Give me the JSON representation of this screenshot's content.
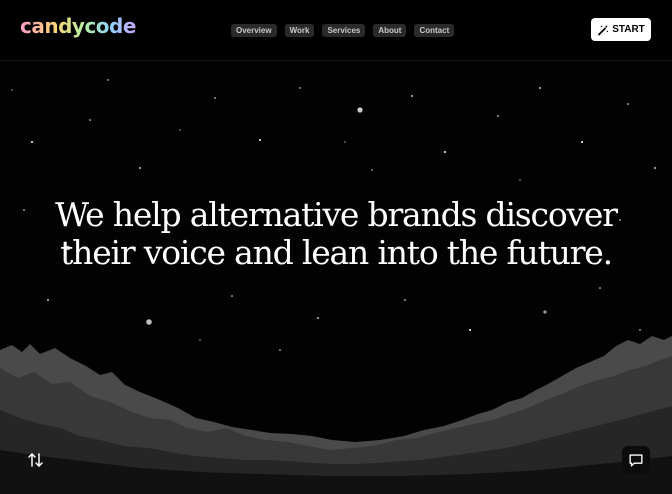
{
  "brand": {
    "logo_text": "candycode"
  },
  "nav": {
    "items": [
      {
        "label": "Overview"
      },
      {
        "label": "Work"
      },
      {
        "label": "Services"
      },
      {
        "label": "About"
      },
      {
        "label": "Contact"
      }
    ]
  },
  "header": {
    "start_label": "START",
    "start_icon": "magic-wand-icon"
  },
  "hero": {
    "headline_line1": "We help alternative brands discover",
    "headline_line2": "their voice and lean into the future."
  },
  "footer_controls": {
    "scroll_icon": "sort-arrows-icon",
    "chat_icon": "chat-bubble-icon"
  },
  "colors": {
    "background": "#000000",
    "text": "#ffffff",
    "nav_pill": "#2a2a2a",
    "mountain_far": "#5a5a5a",
    "mountain_near": "#2e2e2e"
  }
}
